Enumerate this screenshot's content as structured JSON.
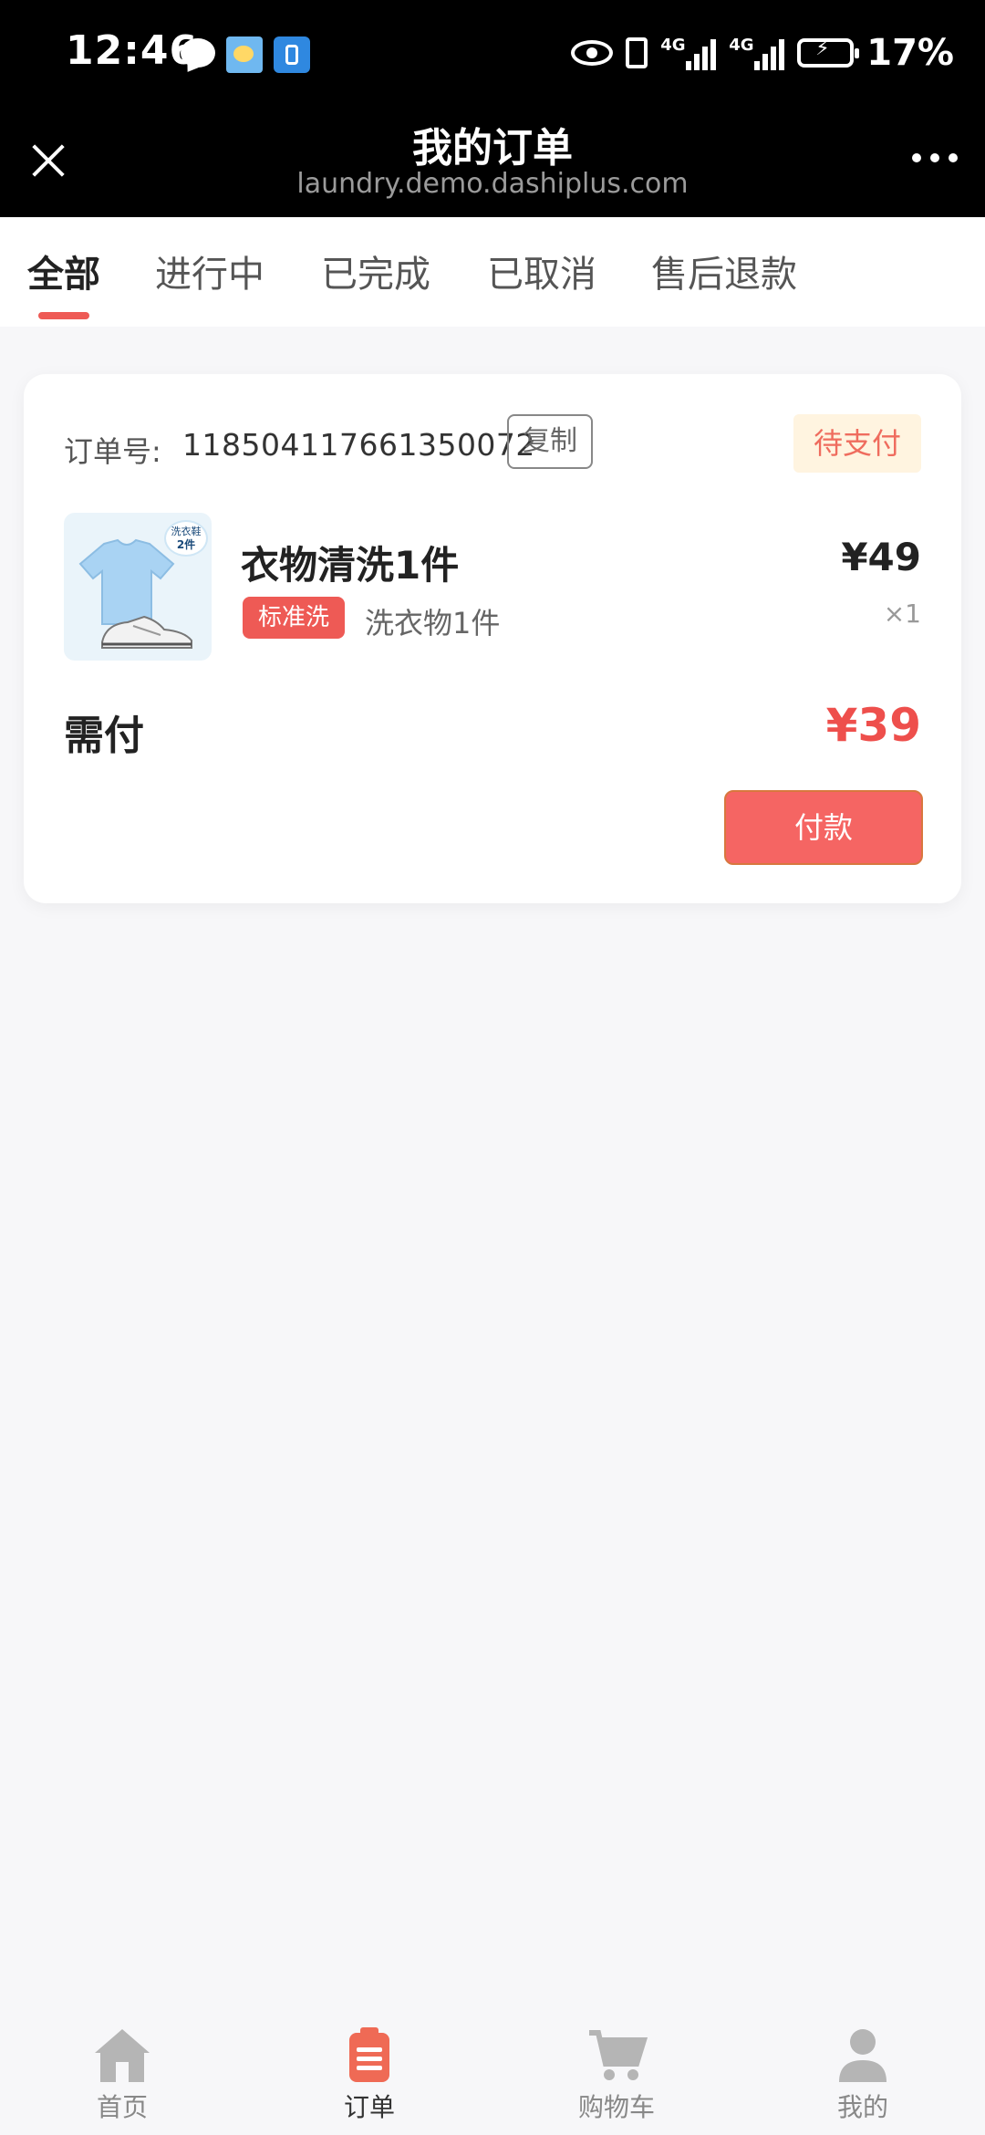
{
  "status_bar": {
    "time": "12:46",
    "battery": "17%",
    "network_1": "4G",
    "network_2": "4G",
    "icons": [
      "chat-icon",
      "weather-icon",
      "app-icon",
      "eye-icon",
      "vibrate-icon",
      "signal-icon",
      "battery-charging-icon"
    ]
  },
  "title_bar": {
    "title": "我的订单",
    "url": "laundry.demo.dashiplus.com"
  },
  "tabs": [
    {
      "label": "全部",
      "active": true
    },
    {
      "label": "进行中"
    },
    {
      "label": "已完成"
    },
    {
      "label": "已取消"
    },
    {
      "label": "售后退款"
    }
  ],
  "order": {
    "order_no_label": "订单号:",
    "order_no": "118504117661350072",
    "copy_label": "复制",
    "status": "待支付",
    "thumb_tag_line1": "洗衣鞋",
    "thumb_tag_line2": "2件",
    "item_name": "衣物清洗1件",
    "wash_tag": "标准洗",
    "item_desc": "洗衣物1件",
    "price": "¥49",
    "qty": "×1",
    "need_pay_label": "需付",
    "need_pay_value": "¥39",
    "pay_label": "付款"
  },
  "bottom_nav": [
    {
      "label": "首页",
      "icon": "home-icon"
    },
    {
      "label": "订单",
      "icon": "order-icon",
      "active": true
    },
    {
      "label": "购物车",
      "icon": "cart-icon"
    },
    {
      "label": "我的",
      "icon": "user-icon"
    }
  ],
  "colors": {
    "accent": "#ee5a55",
    "price_red": "#ee4f4c",
    "badge_bg": "#fff4e0"
  }
}
